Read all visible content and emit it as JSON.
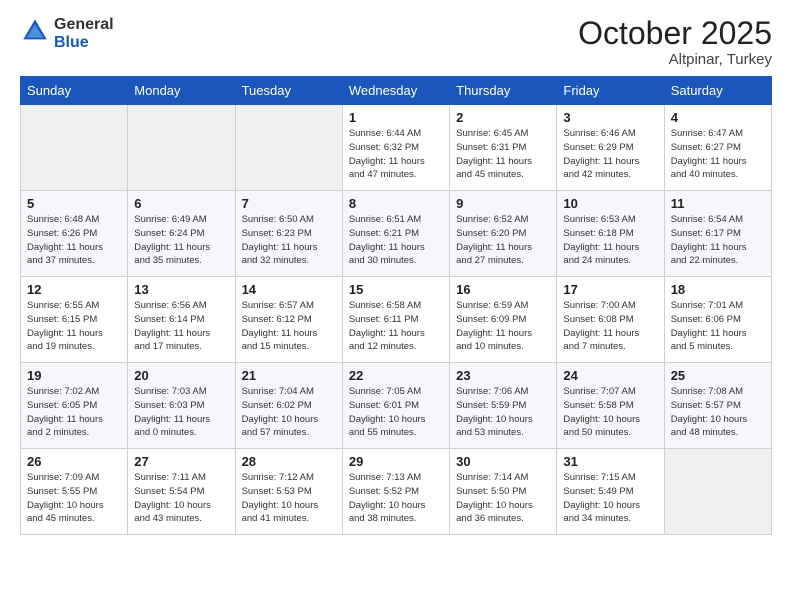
{
  "header": {
    "logo_general": "General",
    "logo_blue": "Blue",
    "title": "October 2025",
    "location": "Altpinar, Turkey"
  },
  "weekdays": [
    "Sunday",
    "Monday",
    "Tuesday",
    "Wednesday",
    "Thursday",
    "Friday",
    "Saturday"
  ],
  "weeks": [
    [
      {
        "day": "",
        "info": ""
      },
      {
        "day": "",
        "info": ""
      },
      {
        "day": "",
        "info": ""
      },
      {
        "day": "1",
        "info": "Sunrise: 6:44 AM\nSunset: 6:32 PM\nDaylight: 11 hours\nand 47 minutes."
      },
      {
        "day": "2",
        "info": "Sunrise: 6:45 AM\nSunset: 6:31 PM\nDaylight: 11 hours\nand 45 minutes."
      },
      {
        "day": "3",
        "info": "Sunrise: 6:46 AM\nSunset: 6:29 PM\nDaylight: 11 hours\nand 42 minutes."
      },
      {
        "day": "4",
        "info": "Sunrise: 6:47 AM\nSunset: 6:27 PM\nDaylight: 11 hours\nand 40 minutes."
      }
    ],
    [
      {
        "day": "5",
        "info": "Sunrise: 6:48 AM\nSunset: 6:26 PM\nDaylight: 11 hours\nand 37 minutes."
      },
      {
        "day": "6",
        "info": "Sunrise: 6:49 AM\nSunset: 6:24 PM\nDaylight: 11 hours\nand 35 minutes."
      },
      {
        "day": "7",
        "info": "Sunrise: 6:50 AM\nSunset: 6:23 PM\nDaylight: 11 hours\nand 32 minutes."
      },
      {
        "day": "8",
        "info": "Sunrise: 6:51 AM\nSunset: 6:21 PM\nDaylight: 11 hours\nand 30 minutes."
      },
      {
        "day": "9",
        "info": "Sunrise: 6:52 AM\nSunset: 6:20 PM\nDaylight: 11 hours\nand 27 minutes."
      },
      {
        "day": "10",
        "info": "Sunrise: 6:53 AM\nSunset: 6:18 PM\nDaylight: 11 hours\nand 24 minutes."
      },
      {
        "day": "11",
        "info": "Sunrise: 6:54 AM\nSunset: 6:17 PM\nDaylight: 11 hours\nand 22 minutes."
      }
    ],
    [
      {
        "day": "12",
        "info": "Sunrise: 6:55 AM\nSunset: 6:15 PM\nDaylight: 11 hours\nand 19 minutes."
      },
      {
        "day": "13",
        "info": "Sunrise: 6:56 AM\nSunset: 6:14 PM\nDaylight: 11 hours\nand 17 minutes."
      },
      {
        "day": "14",
        "info": "Sunrise: 6:57 AM\nSunset: 6:12 PM\nDaylight: 11 hours\nand 15 minutes."
      },
      {
        "day": "15",
        "info": "Sunrise: 6:58 AM\nSunset: 6:11 PM\nDaylight: 11 hours\nand 12 minutes."
      },
      {
        "day": "16",
        "info": "Sunrise: 6:59 AM\nSunset: 6:09 PM\nDaylight: 11 hours\nand 10 minutes."
      },
      {
        "day": "17",
        "info": "Sunrise: 7:00 AM\nSunset: 6:08 PM\nDaylight: 11 hours\nand 7 minutes."
      },
      {
        "day": "18",
        "info": "Sunrise: 7:01 AM\nSunset: 6:06 PM\nDaylight: 11 hours\nand 5 minutes."
      }
    ],
    [
      {
        "day": "19",
        "info": "Sunrise: 7:02 AM\nSunset: 6:05 PM\nDaylight: 11 hours\nand 2 minutes."
      },
      {
        "day": "20",
        "info": "Sunrise: 7:03 AM\nSunset: 6:03 PM\nDaylight: 11 hours\nand 0 minutes."
      },
      {
        "day": "21",
        "info": "Sunrise: 7:04 AM\nSunset: 6:02 PM\nDaylight: 10 hours\nand 57 minutes."
      },
      {
        "day": "22",
        "info": "Sunrise: 7:05 AM\nSunset: 6:01 PM\nDaylight: 10 hours\nand 55 minutes."
      },
      {
        "day": "23",
        "info": "Sunrise: 7:06 AM\nSunset: 5:59 PM\nDaylight: 10 hours\nand 53 minutes."
      },
      {
        "day": "24",
        "info": "Sunrise: 7:07 AM\nSunset: 5:58 PM\nDaylight: 10 hours\nand 50 minutes."
      },
      {
        "day": "25",
        "info": "Sunrise: 7:08 AM\nSunset: 5:57 PM\nDaylight: 10 hours\nand 48 minutes."
      }
    ],
    [
      {
        "day": "26",
        "info": "Sunrise: 7:09 AM\nSunset: 5:55 PM\nDaylight: 10 hours\nand 45 minutes."
      },
      {
        "day": "27",
        "info": "Sunrise: 7:11 AM\nSunset: 5:54 PM\nDaylight: 10 hours\nand 43 minutes."
      },
      {
        "day": "28",
        "info": "Sunrise: 7:12 AM\nSunset: 5:53 PM\nDaylight: 10 hours\nand 41 minutes."
      },
      {
        "day": "29",
        "info": "Sunrise: 7:13 AM\nSunset: 5:52 PM\nDaylight: 10 hours\nand 38 minutes."
      },
      {
        "day": "30",
        "info": "Sunrise: 7:14 AM\nSunset: 5:50 PM\nDaylight: 10 hours\nand 36 minutes."
      },
      {
        "day": "31",
        "info": "Sunrise: 7:15 AM\nSunset: 5:49 PM\nDaylight: 10 hours\nand 34 minutes."
      },
      {
        "day": "",
        "info": ""
      }
    ]
  ]
}
